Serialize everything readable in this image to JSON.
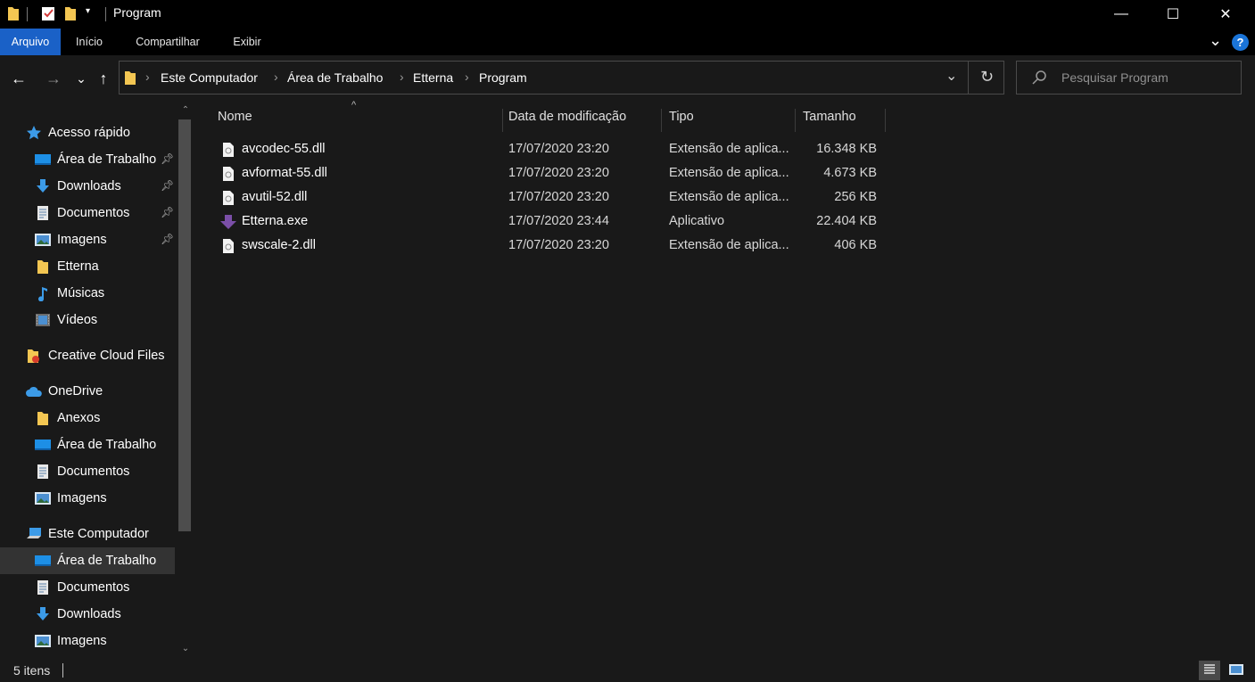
{
  "window": {
    "title": "Program",
    "minimize_glyph": "—",
    "maximize_glyph": "☐",
    "close_glyph": "✕"
  },
  "ribbon": {
    "tabs": [
      "Arquivo",
      "Início",
      "Compartilhar",
      "Exibir"
    ],
    "expand_glyph": "⌄",
    "help_glyph": "?"
  },
  "navigation": {
    "back_glyph": "←",
    "forward_glyph": "→",
    "recent_glyph": "⌄",
    "up_glyph": "↑",
    "breadcrumb": [
      "Este Computador",
      "Área de Trabalho",
      "Etterna",
      "Program"
    ],
    "breadcrumb_sep": "›",
    "dropdown_glyph": "⌄",
    "refresh_glyph": "↻",
    "search_placeholder": "Pesquisar Program"
  },
  "sidebar": {
    "quick_access": {
      "label": "Acesso rápido",
      "items": [
        {
          "label": "Área de Trabalho",
          "icon": "desktop-icon",
          "pinned": true
        },
        {
          "label": "Downloads",
          "icon": "download-icon",
          "pinned": true
        },
        {
          "label": "Documentos",
          "icon": "document-icon",
          "pinned": true
        },
        {
          "label": "Imagens",
          "icon": "pictures-icon",
          "pinned": true
        },
        {
          "label": "Etterna",
          "icon": "folder-icon",
          "pinned": false
        },
        {
          "label": "Músicas",
          "icon": "music-icon",
          "pinned": false
        },
        {
          "label": "Vídeos",
          "icon": "video-icon",
          "pinned": false
        }
      ]
    },
    "creative_cloud": {
      "label": "Creative Cloud Files"
    },
    "onedrive": {
      "label": "OneDrive",
      "items": [
        {
          "label": "Anexos",
          "icon": "folder-icon"
        },
        {
          "label": "Área de Trabalho",
          "icon": "desktop-icon"
        },
        {
          "label": "Documentos",
          "icon": "document-icon"
        },
        {
          "label": "Imagens",
          "icon": "pictures-icon"
        }
      ]
    },
    "this_pc": {
      "label": "Este Computador",
      "items": [
        {
          "label": "Área de Trabalho",
          "icon": "desktop-icon",
          "selected": true
        },
        {
          "label": "Documentos",
          "icon": "document-icon"
        },
        {
          "label": "Downloads",
          "icon": "download-icon"
        },
        {
          "label": "Imagens",
          "icon": "pictures-icon"
        }
      ]
    }
  },
  "file_list": {
    "columns": [
      "Nome",
      "Data de modificação",
      "Tipo",
      "Tamanho"
    ],
    "sort_glyph": "^",
    "files": [
      {
        "name": "avcodec-55.dll",
        "date": "17/07/2020 23:20",
        "type": "Extensão de aplica...",
        "size": "16.348 KB",
        "icon": "dll-file-icon"
      },
      {
        "name": "avformat-55.dll",
        "date": "17/07/2020 23:20",
        "type": "Extensão de aplica...",
        "size": "4.673 KB",
        "icon": "dll-file-icon"
      },
      {
        "name": "avutil-52.dll",
        "date": "17/07/2020 23:20",
        "type": "Extensão de aplica...",
        "size": "256 KB",
        "icon": "dll-file-icon"
      },
      {
        "name": "Etterna.exe",
        "date": "17/07/2020 23:44",
        "type": "Aplicativo",
        "size": "22.404 KB",
        "icon": "etterna-app-icon"
      },
      {
        "name": "swscale-2.dll",
        "date": "17/07/2020 23:20",
        "type": "Extensão de aplica...",
        "size": "406 KB",
        "icon": "dll-file-icon"
      }
    ]
  },
  "status": {
    "item_count": "5 itens"
  },
  "colors": {
    "accent": "#1a61c7",
    "background": "#191919",
    "titlebar": "#000000",
    "folder": "#f3c652",
    "icon_blue": "#3c9be8"
  }
}
